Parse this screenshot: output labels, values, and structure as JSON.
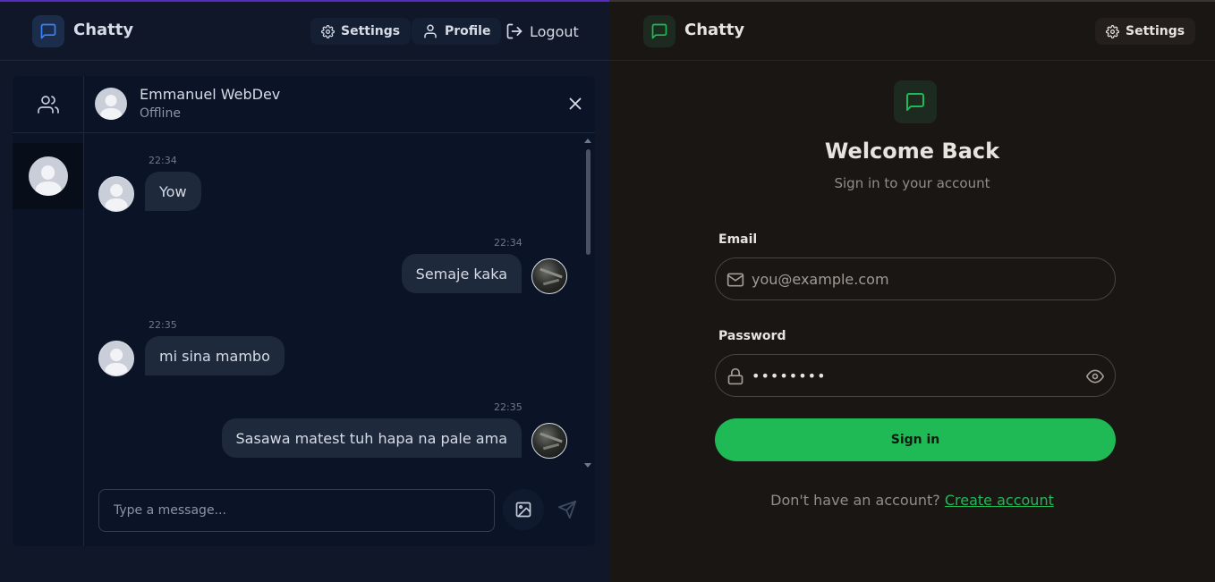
{
  "left_app": {
    "brand": "Chatty",
    "nav": {
      "settings_label": "Settings",
      "profile_label": "Profile",
      "logout_label": "Logout"
    },
    "chat": {
      "contact_name": "Emmanuel WebDev",
      "contact_status": "Offline",
      "messages": [
        {
          "direction": "incoming",
          "time": "22:34",
          "text": "Yow"
        },
        {
          "direction": "outgoing",
          "time": "22:34",
          "text": "Semaje kaka"
        },
        {
          "direction": "incoming",
          "time": "22:35",
          "text": "mi sina mambo"
        },
        {
          "direction": "outgoing",
          "time": "22:35",
          "text": "Sasawa matest tuh hapa na pale ama"
        }
      ],
      "input_placeholder": "Type a message..."
    },
    "colors": {
      "accent": "#3b82f6",
      "background": "#0f1729",
      "bubble": "#1e293b"
    }
  },
  "right_app": {
    "brand": "Chatty",
    "nav": {
      "settings_label": "Settings"
    },
    "login": {
      "title": "Welcome Back",
      "subtitle": "Sign in to your account",
      "email_label": "Email",
      "email_placeholder": "you@example.com",
      "password_label": "Password",
      "password_value": "••••••••",
      "submit_label": "Sign in",
      "footer_text": "Don't have an account?",
      "footer_link": "Create account"
    },
    "colors": {
      "accent": "#1fba55",
      "background": "#1a1614"
    }
  },
  "icons": [
    "message-square-icon",
    "gear-icon",
    "user-icon",
    "logout-icon",
    "users-icon",
    "close-icon",
    "image-icon",
    "send-icon",
    "mail-icon",
    "lock-icon",
    "eye-icon"
  ]
}
